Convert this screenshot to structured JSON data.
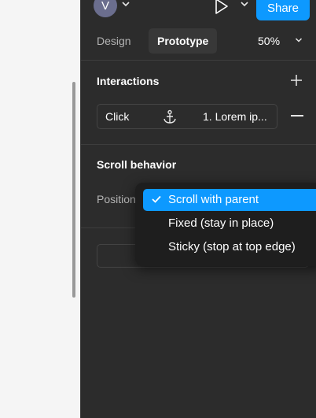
{
  "header": {
    "avatar_initial": "V",
    "share_label": "Share"
  },
  "tabs": {
    "design_label": "Design",
    "prototype_label": "Prototype",
    "active": "Prototype",
    "zoom_value": "50%"
  },
  "interactions": {
    "title": "Interactions",
    "items": [
      {
        "trigger": "Click",
        "destination": "1. Lorem ip..."
      }
    ]
  },
  "scroll_behavior": {
    "title": "Scroll behavior",
    "position_label": "Position",
    "dropdown_options": [
      {
        "label": "Scroll with parent",
        "selected": true
      },
      {
        "label": "Fixed (stay in place)",
        "selected": false
      },
      {
        "label": "Sticky (stop at top edge)",
        "selected": false
      }
    ]
  },
  "colors": {
    "accent": "#0d99ff",
    "panel_bg": "#2c2c2c",
    "menu_bg": "#1e1e1e",
    "canvas_bg": "#f5f5f5"
  },
  "icons": {
    "avatar_chevron": "chevron-down-icon",
    "play": "play-icon",
    "play_chevron": "chevron-down-icon",
    "zoom_chevron": "chevron-down-icon",
    "add_interaction": "plus-icon",
    "anchor": "anchor-icon",
    "remove_interaction": "minus-icon",
    "selected_check": "check-icon"
  }
}
